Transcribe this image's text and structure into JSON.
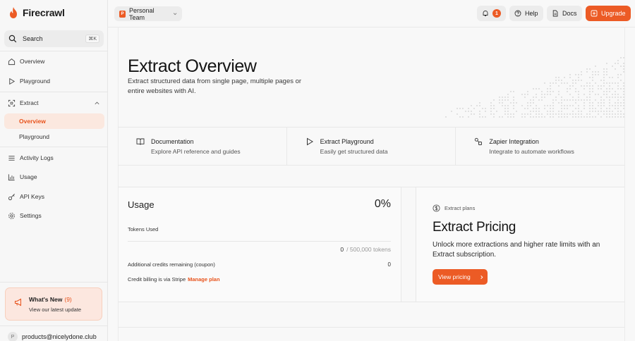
{
  "brand": {
    "name": "Firecrawl"
  },
  "search": {
    "label": "Search",
    "shortcut": "⌘K"
  },
  "nav": {
    "overview": "Overview",
    "playground": "Playground",
    "extract": "Extract",
    "extract_overview": "Overview",
    "extract_playground": "Playground",
    "activity_logs": "Activity Logs",
    "usage": "Usage",
    "api_keys": "API Keys",
    "settings": "Settings"
  },
  "whats_new": {
    "title": "What's New",
    "count": "(9)",
    "subtitle": "View our latest update"
  },
  "account": {
    "avatar_letter": "P",
    "email": "products@nicelydone.club"
  },
  "topbar": {
    "team_letter": "P",
    "team_name": "Personal Team",
    "notification_count": "1",
    "help": "Help",
    "docs": "Docs",
    "upgrade": "Upgrade"
  },
  "hero": {
    "title": "Extract Overview",
    "subtitle": "Extract structured data from single page, multiple pages or entire websites with AI."
  },
  "cards": [
    {
      "title": "Documentation",
      "subtitle": "Explore API reference and guides"
    },
    {
      "title": "Extract Playground",
      "subtitle": "Easily get structured data"
    },
    {
      "title": "Zapier Integration",
      "subtitle": "Integrate to automate workflows"
    }
  ],
  "usage": {
    "title": "Usage",
    "percent": "0%",
    "tokens_label": "Tokens Used",
    "tokens_used": "0",
    "tokens_total": "/ 500,000 tokens",
    "additional_label": "Additional credits remaining (coupon)",
    "additional_value": "0",
    "billing_text": "Credit billing is via Stripe",
    "manage_link": "Manage plan"
  },
  "pricing": {
    "label": "Extract plans",
    "title": "Extract Pricing",
    "description": "Unlock more extractions and higher rate limits with an Extract subscription.",
    "button": "View pricing"
  },
  "colors": {
    "accent": "#ec5b25",
    "active_bg": "#fbe8df"
  }
}
